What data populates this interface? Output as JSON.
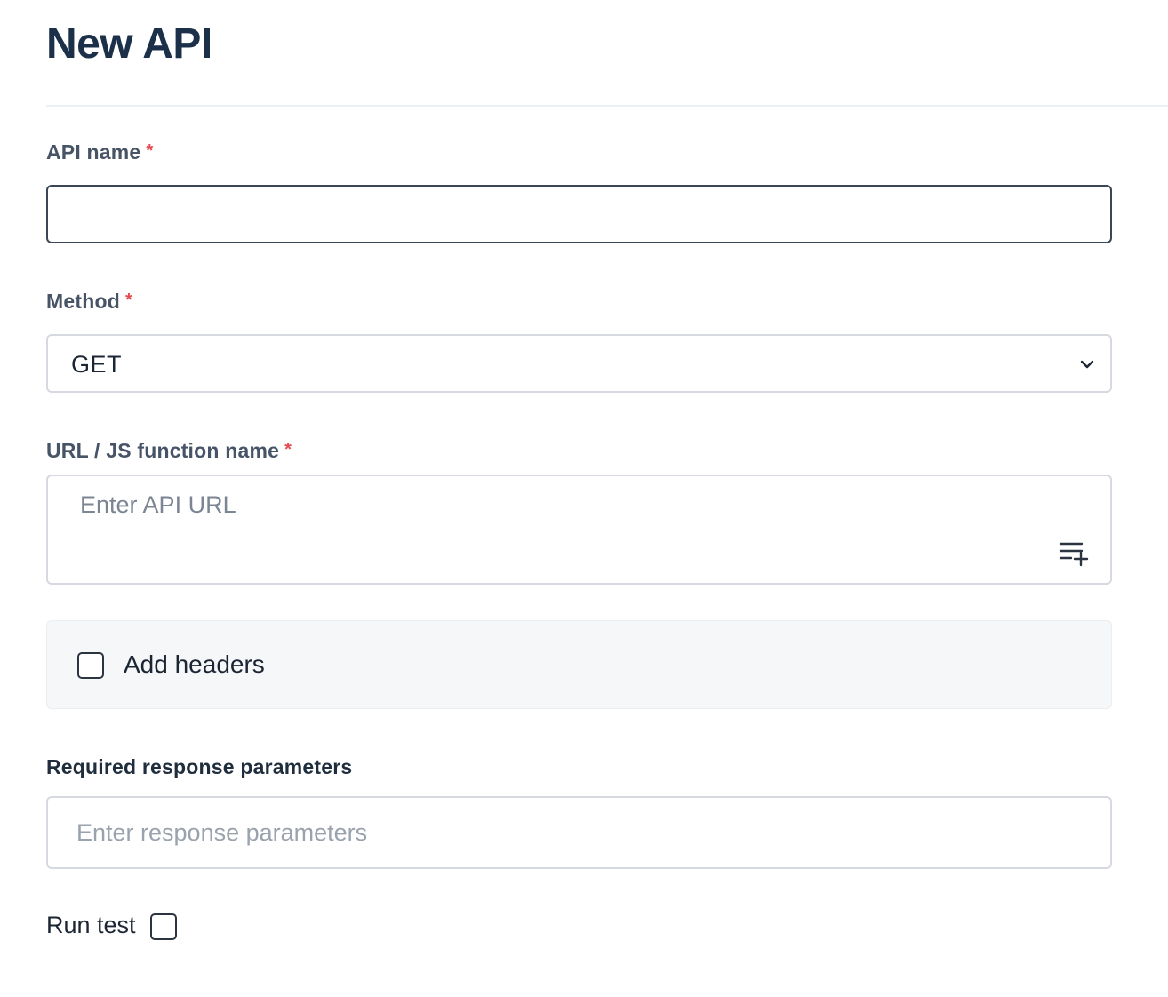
{
  "page": {
    "title": "New API"
  },
  "form": {
    "api_name": {
      "label": "API name",
      "required_mark": "*",
      "value": ""
    },
    "method": {
      "label": "Method",
      "required_mark": "*",
      "selected": "GET"
    },
    "url": {
      "label": "URL / JS function name",
      "required_mark": "*",
      "placeholder": "Enter API URL",
      "value": "",
      "insert_icon": "playlist-add-icon"
    },
    "headers": {
      "label": "Add headers",
      "checked": false
    },
    "response_params": {
      "label": "Required response parameters",
      "placeholder": "Enter response parameters",
      "value": ""
    },
    "run_test": {
      "label": "Run test",
      "checked": false
    }
  },
  "colors": {
    "title": "#1c3049",
    "required": "#e5484d",
    "panel_bg": "#f5f7f9"
  }
}
